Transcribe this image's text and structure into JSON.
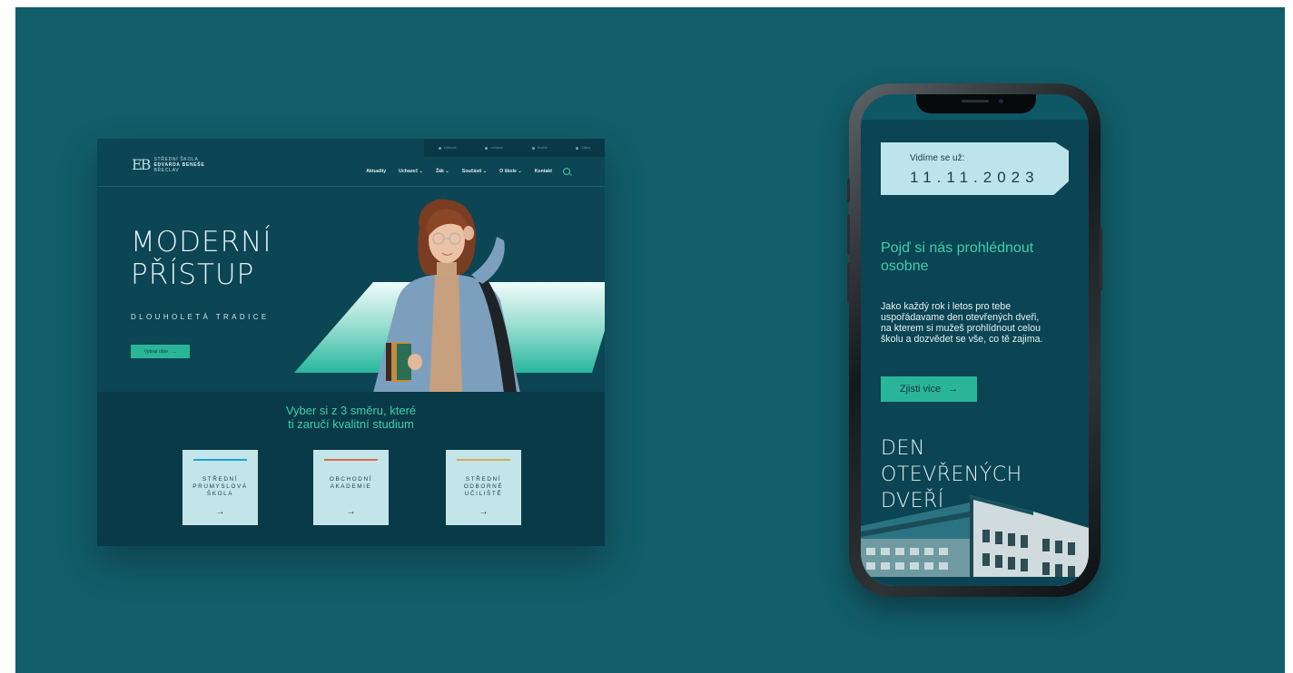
{
  "desktop": {
    "utility_links": [
      "Odborné",
      "Uchazeč",
      "Rodiče",
      "Zájmy"
    ],
    "logo": {
      "mark": "EB",
      "line1": "STŘEDNÍ ŠKOLA",
      "line2": "EDVARDA BENEŠE",
      "line3": "BŘECLAV"
    },
    "nav": [
      "Aktuality",
      "Uchazeč ⌄",
      "Žák ⌄",
      "Součásti ⌄",
      "O škole ⌄",
      "Kontakt"
    ],
    "hero": {
      "title_line1": "MODERNÍ",
      "title_line2": "PŘÍSTUP",
      "subtitle": "DLOUHOLETÁ TRADICE",
      "button": "Vybrat obor",
      "button_arrow": "→"
    },
    "section": {
      "title_line1": "Vyber si z 3 směru, které",
      "title_line2": "ti zaručí kvalitní studium"
    },
    "fields": [
      {
        "lines": [
          "STŘEDNÍ",
          "PRUMYSLOVÁ",
          "ŠKOLA"
        ],
        "color": "#1aa6cf",
        "arrow": "→"
      },
      {
        "lines": [
          "OBCHODNÍ",
          "AKADEMIE"
        ],
        "color": "#e0694e",
        "arrow": "→"
      },
      {
        "lines": [
          "STŘEDNÍ",
          "ODBORNÉ",
          "UČILIŠTĚ"
        ],
        "color": "#d9a95a",
        "arrow": "→"
      }
    ],
    "colors": {
      "accent": "#2bb598",
      "background": "#0c4554",
      "canvas": "#125d6a"
    }
  },
  "phone": {
    "date_label": "Vidíme se už:",
    "date_value": "11.11.2023",
    "heading_line1": "Pojď si nás prohlédnout",
    "heading_line2": "osobne",
    "body_lines": [
      "Jako každý rok i letos pro tebe",
      "uspořádavame den otevřených dveři,",
      "na kterem si mužeš prohlídnout celou",
      "školu a dozvědet se vše, co tě zajima."
    ],
    "button": "Zjisti vice",
    "button_arrow": "→",
    "big_title": [
      "DEN",
      "OTEVŘENÝCH",
      "DVEŘÍ"
    ]
  }
}
